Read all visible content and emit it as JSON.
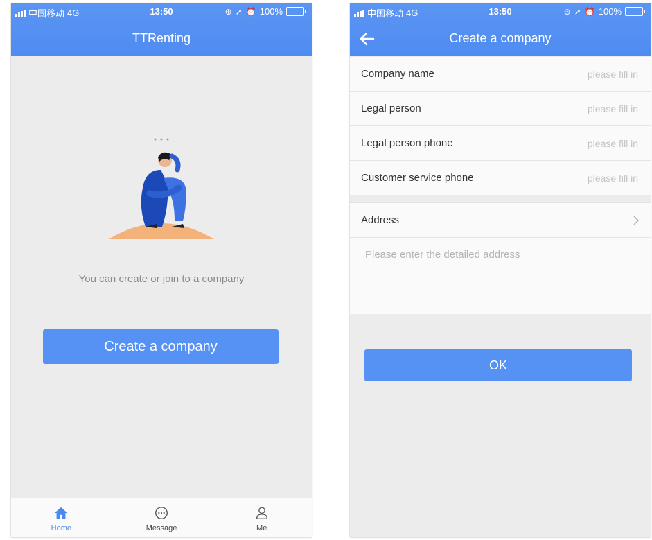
{
  "status_bar": {
    "carrier": "中国移动",
    "network": "4G",
    "time": "13:50",
    "battery": "100%",
    "battery_level": 1.0
  },
  "home": {
    "title": "TTRenting",
    "empty_text": "You can create or join to a company",
    "create_button": "Create a company",
    "tabs": [
      {
        "label": "Home",
        "icon": "home-icon"
      },
      {
        "label": "Message",
        "icon": "message-icon"
      },
      {
        "label": "Me",
        "icon": "person-icon"
      }
    ]
  },
  "create": {
    "title": "Create a company",
    "fields": [
      {
        "label": "Company name",
        "placeholder": "please fill in",
        "value": ""
      },
      {
        "label": "Legal person",
        "placeholder": "please fill in",
        "value": ""
      },
      {
        "label": "Legal person phone",
        "placeholder": "please fill in",
        "value": ""
      },
      {
        "label": "Customer service phone",
        "placeholder": "please fill in",
        "value": ""
      }
    ],
    "address_label": "Address",
    "address_placeholder": "Please enter the detailed address",
    "ok_button": "OK"
  },
  "colors": {
    "primary": "#4f8cf2",
    "button": "#5592f3",
    "background": "#ececec",
    "tab_active": "#4a8af0",
    "sand": "#f2b27a"
  }
}
